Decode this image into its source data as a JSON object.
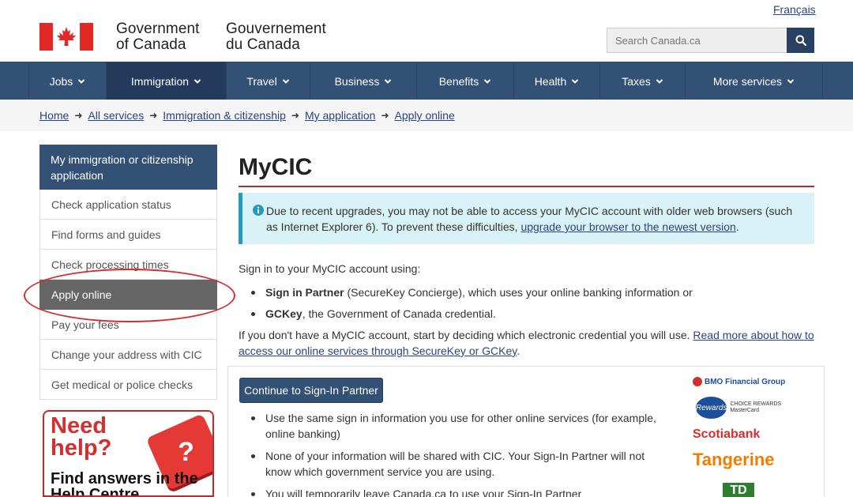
{
  "header": {
    "language_link": "Français",
    "signature_en": [
      "Government",
      "of Canada"
    ],
    "signature_fr": [
      "Gouvernement",
      "du Canada"
    ],
    "search_placeholder": "Search Canada.ca"
  },
  "menu": [
    {
      "label": "Jobs",
      "width": 98
    },
    {
      "label": "Immigration",
      "width": 152,
      "active": true
    },
    {
      "label": "Travel",
      "width": 106
    },
    {
      "label": "Business",
      "width": 135
    },
    {
      "label": "Benefits",
      "width": 123
    },
    {
      "label": "Health",
      "width": 109
    },
    {
      "label": "Taxes",
      "width": 108
    },
    {
      "label": "More services",
      "width": 174
    }
  ],
  "breadcrumb": [
    "Home",
    "All services",
    "Immigration & citizenship",
    "My application",
    "Apply online"
  ],
  "sidebar": {
    "heading": "My immigration or citizenship application",
    "items": [
      {
        "label": "Check application status"
      },
      {
        "label": "Find forms and guides"
      },
      {
        "label": "Check processing times"
      },
      {
        "label": "Apply online",
        "active": true
      },
      {
        "label": "Pay your fees"
      },
      {
        "label": "Change your address with CIC"
      },
      {
        "label": "Get medical or police checks"
      }
    ]
  },
  "help": {
    "need": "Need help?",
    "find": "Find answers in the Help Centre",
    "key": "?"
  },
  "main": {
    "title": "MyCIC",
    "alert_text": "Due to recent upgrades, you may not be able to access your MyCIC account with older web browsers (such as Internet Explorer 6). To prevent these difficulties,",
    "alert_link": "upgrade your browser to the newest version",
    "alert_end": ".",
    "intro": "Sign in to your MyCIC account using:",
    "options": [
      {
        "bold": "Sign in Partner",
        "rest": " (SecureKey Concierge), which uses your online banking information or"
      },
      {
        "bold": "GCKey",
        "rest": ", the Government of Canada credential."
      }
    ],
    "para_text": "If you don't have a MyCIC account, start by deciding which electronic credential you will use.",
    "para_link": "Read more about how to access our online services through SecureKey or GCKey",
    "para_end": ".",
    "button": "Continue to Sign-In Partner",
    "partner_points": [
      "Use the same sign in information you use for other online services (for example, online banking)",
      "None of your information will be shared with CIC. Your Sign-In Partner will not know which government service you are using.",
      "You will temporarily leave Canada.ca to use your Sign-In Partner"
    ]
  },
  "logos": {
    "bmo": "BMO Financial Group",
    "card_oval": "Rewards",
    "card_text": "CHOICE REWARDS MasterCard",
    "scotia": "Scotiabank",
    "tangerine": "Tangerine",
    "td": "TD"
  },
  "colors": {
    "nav": "#335075",
    "link": "#2b4380",
    "rule": "#b32d2e",
    "alert_bg": "#d9f2f7"
  }
}
